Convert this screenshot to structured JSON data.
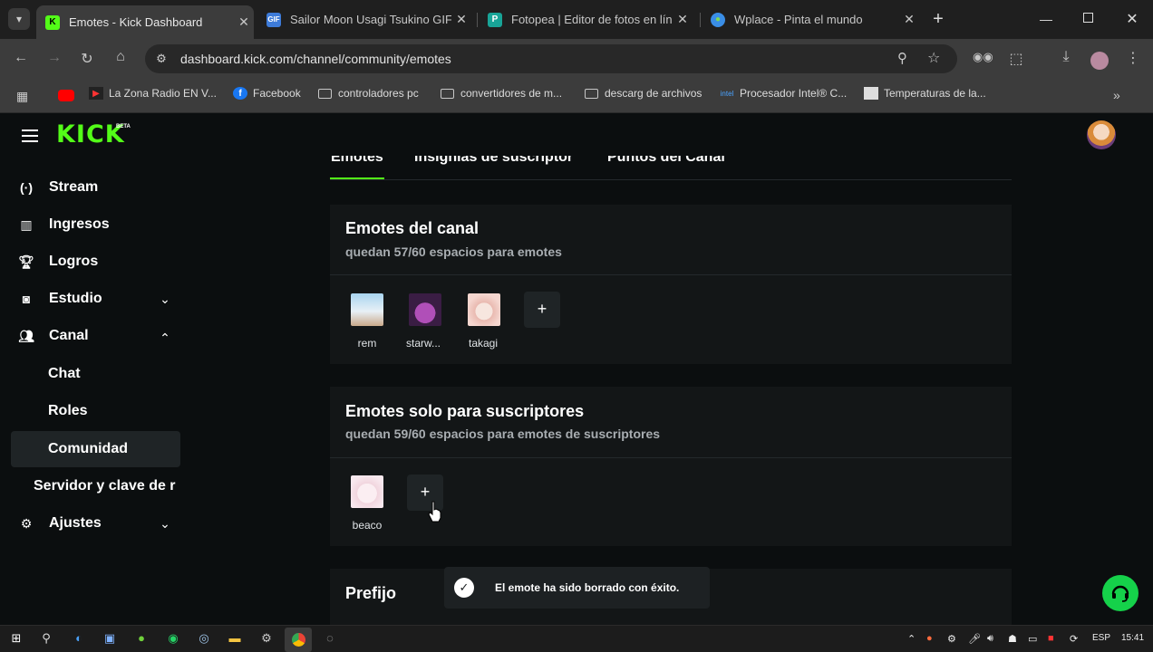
{
  "browser": {
    "tabs": [
      {
        "title": "Emotes - Kick Dashboard",
        "active": true
      },
      {
        "title": "Sailor Moon Usagi Tsukino GIF",
        "active": false
      },
      {
        "title": "Fotopea | Editor de fotos en lín",
        "active": false
      },
      {
        "title": "Wplace - Pinta el mundo",
        "active": false
      }
    ],
    "new_tab": "+",
    "url": "dashboard.kick.com/channel/community/emotes",
    "bookmarks": [
      "La Zona Radio EN V...",
      "Facebook",
      "controladores pc",
      "convertidores de m...",
      "descarg de archivos",
      "Procesador Intel® C...",
      "Temperaturas de la..."
    ]
  },
  "sidebar": {
    "logo": "KICK",
    "logo_badge": "BETA",
    "items": [
      {
        "label": "Stream"
      },
      {
        "label": "Ingresos"
      },
      {
        "label": "Logros"
      },
      {
        "label": "Estudio"
      },
      {
        "label": "Canal"
      },
      {
        "label": "Ajustes"
      }
    ],
    "canal_subitems": [
      "Chat",
      "Roles",
      "Comunidad",
      "Servidor y clave de r"
    ]
  },
  "main": {
    "tabs": [
      "Emotes",
      "Insignias de suscriptor",
      "Puntos del Canal"
    ],
    "channel_emotes": {
      "title": "Emotes del canal",
      "subtitle": "quedan 57/60 espacios para emotes",
      "emotes": [
        "rem",
        "starw...",
        "takagi"
      ]
    },
    "sub_emotes": {
      "title": "Emotes solo para suscriptores",
      "subtitle": "quedan 59/60 espacios para emotes de suscriptores",
      "emotes": [
        "beaco"
      ]
    },
    "add_label": "+",
    "prefix_title": "Prefijo"
  },
  "toast": {
    "message": "El emote ha sido borrado con éxito."
  },
  "taskbar": {
    "lang": "ESP",
    "time": "15:41"
  }
}
